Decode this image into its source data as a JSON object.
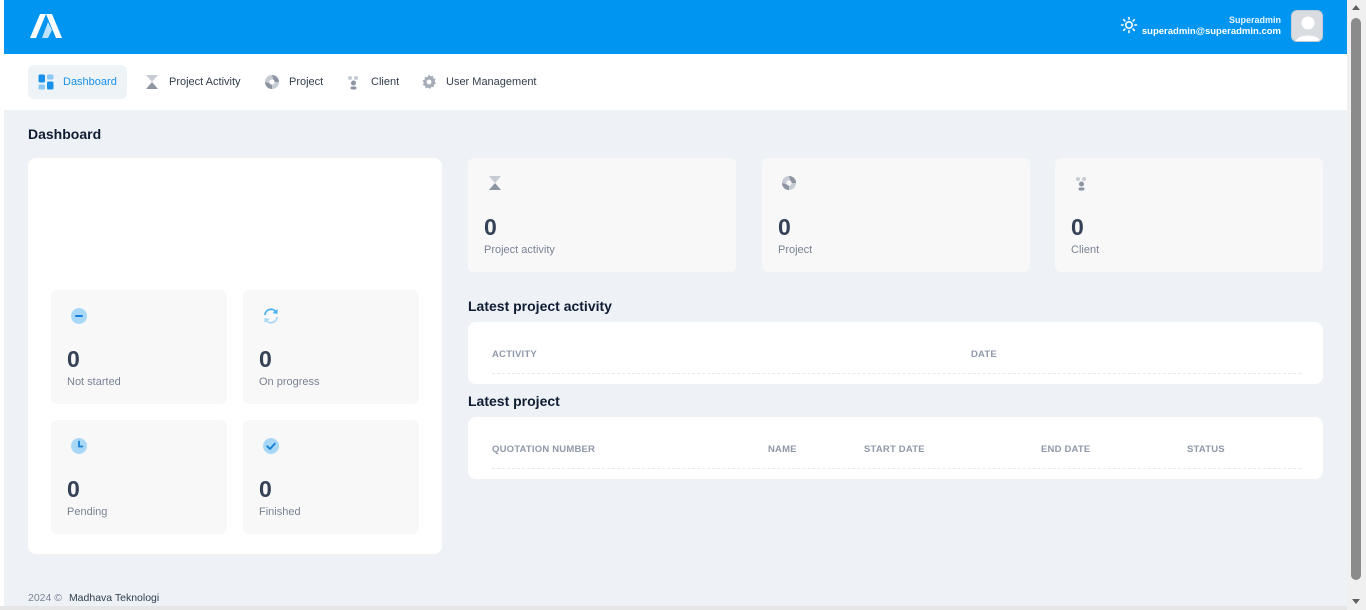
{
  "header": {
    "user_name": "Superadmin",
    "user_email": "superadmin@superadmin.com",
    "brand_color": "#0095f0"
  },
  "nav": {
    "items": [
      {
        "label": "Dashboard",
        "icon": "dashboard-grid-icon",
        "active": true
      },
      {
        "label": "Project Activity",
        "icon": "hourglass-icon",
        "active": false
      },
      {
        "label": "Project",
        "icon": "aperture-icon",
        "active": false
      },
      {
        "label": "Client",
        "icon": "people-icon",
        "active": false
      },
      {
        "label": "User Management",
        "icon": "gear-icon",
        "active": false
      }
    ]
  },
  "page": {
    "title": "Dashboard"
  },
  "status_stats": [
    {
      "value": "0",
      "label": "Not started",
      "icon": "minus-circle-icon"
    },
    {
      "value": "0",
      "label": "On progress",
      "icon": "refresh-icon"
    },
    {
      "value": "0",
      "label": "Pending",
      "icon": "clock-icon"
    },
    {
      "value": "0",
      "label": "Finished",
      "icon": "check-circle-icon"
    }
  ],
  "summary_stats": [
    {
      "value": "0",
      "label": "Project activity",
      "icon": "hourglass-icon"
    },
    {
      "value": "0",
      "label": "Project",
      "icon": "aperture-icon"
    },
    {
      "value": "0",
      "label": "Client",
      "icon": "people-icon"
    }
  ],
  "latest_activity": {
    "title": "Latest project activity",
    "columns": [
      "ACTIVITY",
      "DATE"
    ],
    "rows": []
  },
  "latest_project": {
    "title": "Latest project",
    "columns": [
      "QUOTATION NUMBER",
      "NAME",
      "START DATE",
      "END DATE",
      "STATUS"
    ],
    "rows": []
  },
  "footer": {
    "year": "2024 ©",
    "company": "Madhava Teknologi"
  }
}
